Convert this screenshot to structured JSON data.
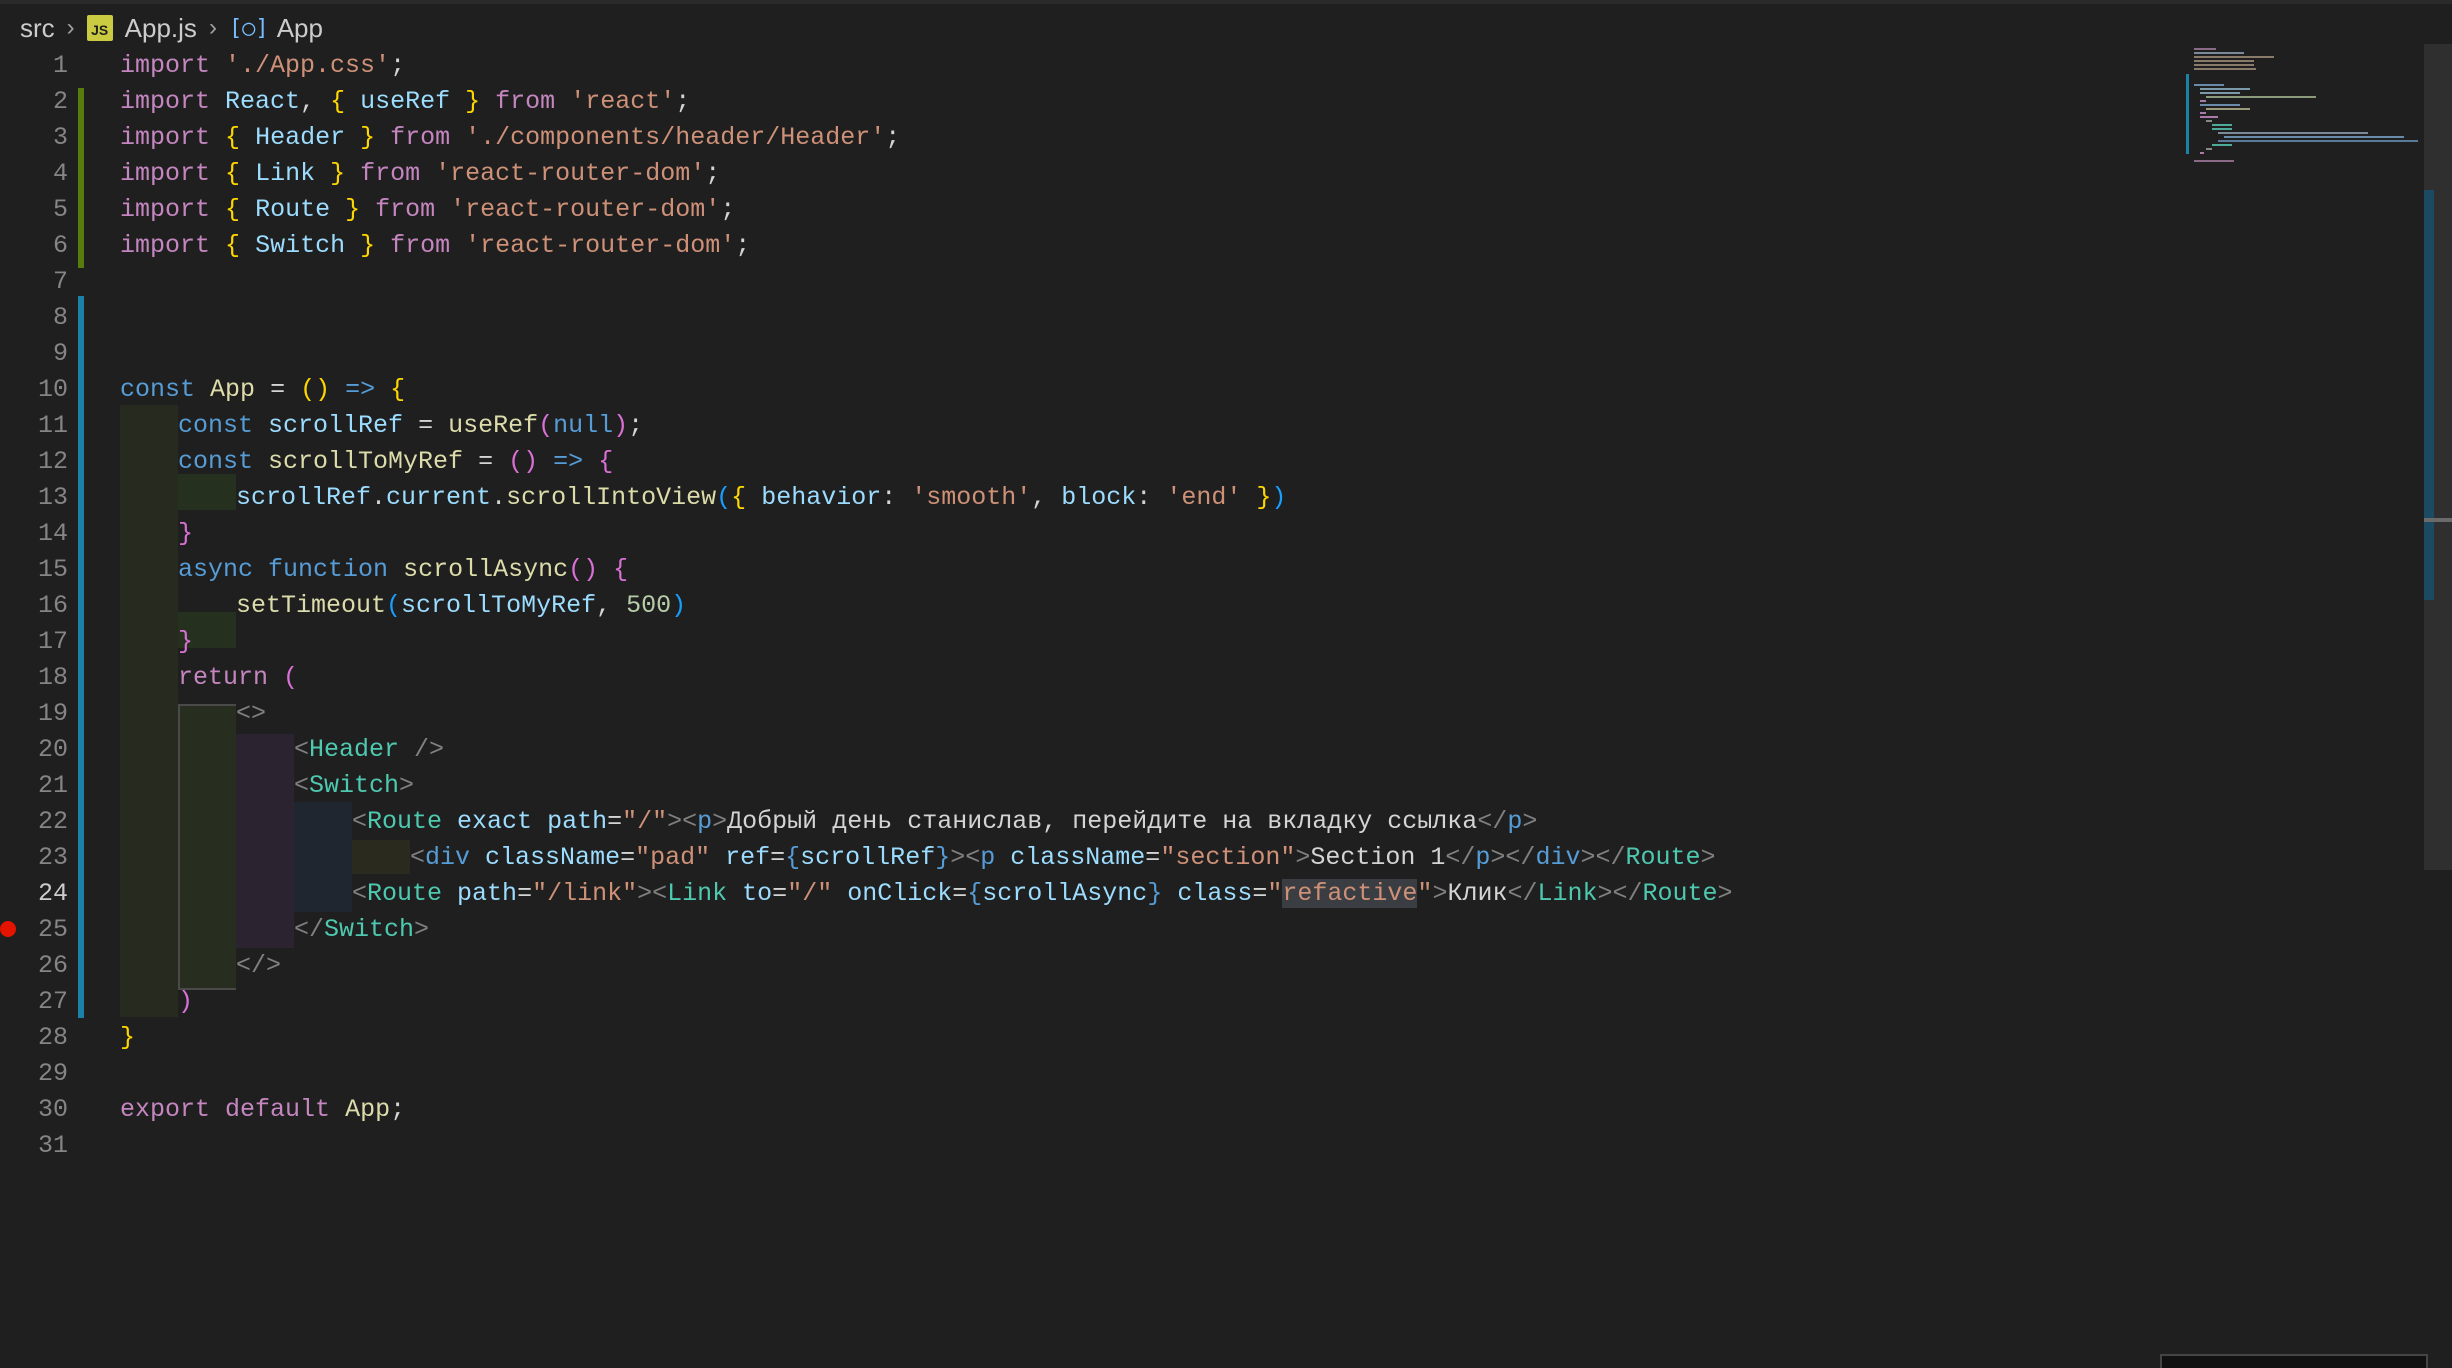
{
  "theme": {
    "background": "#1f1f1f",
    "accent": "#1b81a8"
  },
  "breadcrumb": {
    "folder": "src",
    "file_badge": "JS",
    "file": "App.js",
    "symbol": "App"
  },
  "gutter": {
    "line_numbers": [
      "1",
      "2",
      "3",
      "4",
      "5",
      "6",
      "7",
      "8",
      "9",
      "10",
      "11",
      "12",
      "13",
      "14",
      "15",
      "16",
      "17",
      "18",
      "19",
      "20",
      "21",
      "22",
      "23",
      "24",
      "25",
      "26",
      "27",
      "28",
      "29",
      "30",
      "31"
    ],
    "active_line": "24",
    "breakpoint_line": "25"
  },
  "code": {
    "l1": {
      "t1": "import",
      "t2": "'./App.css'",
      "t3": ";"
    },
    "l2": {
      "t1": "import",
      "t2": "React",
      "t3": ", ",
      "t4": "{",
      "t5": "useRef",
      "t6": "}",
      "t7": "from",
      "t8": "'react'",
      "t9": ";"
    },
    "l3": {
      "t1": "import",
      "t2": "{",
      "t3": "Header",
      "t4": "}",
      "t5": "from",
      "t6": "'./components/header/Header'",
      "t7": ";"
    },
    "l4": {
      "t1": "import",
      "t2": "{",
      "t3": "Link",
      "t4": "}",
      "t5": "from",
      "t6": "'react-router-dom'",
      "t7": ";"
    },
    "l5": {
      "t1": "import",
      "t2": "{",
      "t3": "Route",
      "t4": "}",
      "t5": "from",
      "t6": "'react-router-dom'",
      "t7": ";"
    },
    "l6": {
      "t1": "import",
      "t2": "{",
      "t3": "Switch",
      "t4": "}",
      "t5": "from",
      "t6": "'react-router-dom'",
      "t7": ";"
    },
    "l10": {
      "t1": "const",
      "t2": "App",
      "t3": "=",
      "t4": "()",
      "t5": "=>",
      "t6": "{"
    },
    "l11": {
      "t1": "const",
      "t2": "scrollRef",
      "t3": "=",
      "t4": "useRef",
      "t5": "(",
      "t6": "null",
      "t7": ")",
      "t8": ";"
    },
    "l12": {
      "t1": "const",
      "t2": "scrollToMyRef",
      "t3": "=",
      "t4": "()",
      "t5": "=>",
      "t6": "{"
    },
    "l13": {
      "t1": "scrollRef",
      "t2": ".",
      "t3": "current",
      "t4": ".",
      "t5": "scrollIntoView",
      "t6": "(",
      "t7": "{",
      "t8": "behavior",
      "t9": ": ",
      "t10": "'smooth'",
      "t11": ", ",
      "t12": "block",
      "t13": ": ",
      "t14": "'end'",
      "t15": "}",
      "t16": ")"
    },
    "l14": {
      "t1": "}"
    },
    "l15": {
      "t1": "async",
      "t2": "function",
      "t3": "scrollAsync",
      "t4": "()",
      "t5": "{"
    },
    "l16": {
      "t1": "setTimeout",
      "t2": "(",
      "t3": "scrollToMyRef",
      "t4": ", ",
      "t5": "500",
      "t6": ")"
    },
    "l17": {
      "t1": "}"
    },
    "l18": {
      "t1": "return",
      "t2": "("
    },
    "l19": {
      "t1": "<>"
    },
    "l20": {
      "t1": "<",
      "t2": "Header",
      "t3": " />"
    },
    "l21": {
      "t1": "<",
      "t2": "Switch",
      "t3": ">"
    },
    "l22": {
      "t1": "<",
      "t2": "Route",
      "t3": "exact",
      "t4": "path",
      "t5": "=",
      "t6": "\"/\"",
      "t7": "><",
      "t8": "p",
      "t9": ">",
      "t10": "Добрый день станислав, перейдите на вкладку ссылка",
      "t11": "</",
      "t12": "p",
      "t13": ">"
    },
    "l23": {
      "t1": "<",
      "t2": "div",
      "t3": "className",
      "t4": "=",
      "t5": "\"pad\"",
      "t6": "ref",
      "t7": "=",
      "t8": "{",
      "t9": "scrollRef",
      "t10": "}",
      "t11": "><",
      "t12": "p",
      "t13": "className",
      "t14": "=",
      "t15": "\"section\"",
      "t16": ">",
      "t17": "Section 1",
      "t18": "</",
      "t19": "p",
      "t20": "></",
      "t21": "div",
      "t22": "></",
      "t23": "Route",
      "t24": ">"
    },
    "l24": {
      "t1": "<",
      "t2": "Route",
      "t3": "path",
      "t4": "=",
      "t5": "\"/link\"",
      "t6": "><",
      "t7": "Link",
      "t8": "to",
      "t9": "=",
      "t10": "\"/\"",
      "t11": "onClick",
      "t12": "=",
      "t13": "{",
      "t14": "scrollAsync",
      "t15": "}",
      "t16": "class",
      "t17": "=",
      "t18": "\"",
      "t19": "refactive",
      "t20": "\"",
      "t21": ">",
      "t22": "Клик",
      "t23": "</",
      "t24": "Link",
      "t25": "></",
      "t26": "Route",
      "t27": ">"
    },
    "l25": {
      "t1": "</",
      "t2": "Switch",
      "t3": ">"
    },
    "l26": {
      "t1": "</>"
    },
    "l27": {
      "t1": ")"
    },
    "l28": {
      "t1": "}"
    },
    "l30": {
      "t1": "export",
      "t2": "default",
      "t3": "App",
      "t4": ";"
    }
  }
}
